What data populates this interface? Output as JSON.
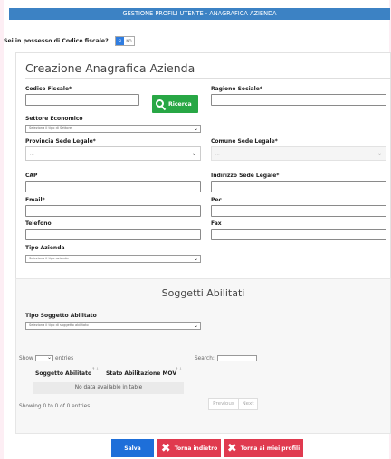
{
  "header": {
    "title": "GESTIONE PROFILI UTENTE - ANAGRAFICA AZIENDA"
  },
  "cf_question": {
    "label": "Sei in possesso di Codice fiscale?",
    "yes": "SI",
    "no": "NO"
  },
  "form": {
    "title": "Creazione Anagrafica Azienda",
    "codice_fiscale": {
      "label": "Codice Fiscale*",
      "value": ""
    },
    "ricerca_button": "Ricerca",
    "ragione_sociale": {
      "label": "Ragione Sociale*",
      "value": ""
    },
    "settore": {
      "label": "Settore Economico",
      "selected": "Seleziona il tipo di Settore"
    },
    "provincia": {
      "label": "Provincia Sede Legale*",
      "selected": "..."
    },
    "comune": {
      "label": "Comune Sede Legale*",
      "selected": "..."
    },
    "cap": {
      "label": "CAP",
      "value": ""
    },
    "indirizzo": {
      "label": "Indirizzo Sede Legale*",
      "value": ""
    },
    "email": {
      "label": "Email*",
      "value": ""
    },
    "pec": {
      "label": "Pec",
      "value": ""
    },
    "telefono": {
      "label": "Telefono",
      "value": ""
    },
    "fax": {
      "label": "Fax",
      "value": ""
    },
    "tipo_azienda": {
      "label": "Tipo Azienda",
      "selected": "Seleziona il tipo azienda"
    }
  },
  "soggetti": {
    "title": "Soggetti Abilitati",
    "tipo": {
      "label": "Tipo Soggetto Abilitato",
      "selected": "Seleziona il tipo di soggetto abilitato"
    },
    "table": {
      "show_label": "Show",
      "entries_label": "entries",
      "search_label": "Search:",
      "columns": [
        "Soggetto Abilitato",
        "Stato Abilitazione MOV"
      ],
      "empty": "No data available in table",
      "info": "Showing 0 to 0 of 0 entries",
      "previous": "Previous",
      "next": "Next"
    }
  },
  "actions": {
    "salva": "Salva",
    "indietro": "Torna indietro",
    "profili": "Torna ai miei profili"
  },
  "colors": {
    "header": "#3c82c4",
    "ricerca": "#28a745",
    "salva": "#1e6fd9",
    "danger": "#e03a4f"
  }
}
